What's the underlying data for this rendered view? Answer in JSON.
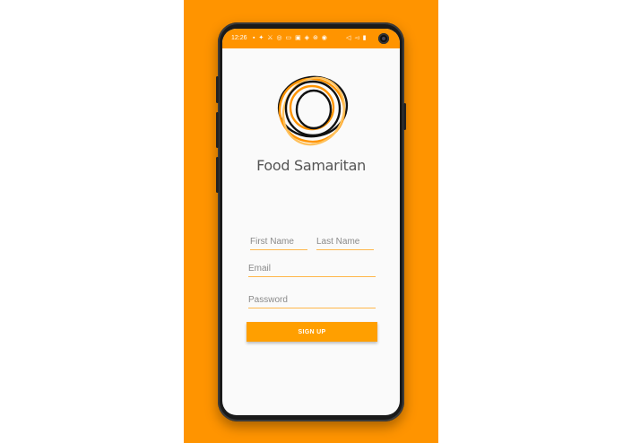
{
  "status_bar": {
    "time": "12:26",
    "left_icons": "▪ ✦ ⚔ ◎ ▭ ▣ ◈ ⊛ ◉",
    "right_icons": "◁ ◅ ▮"
  },
  "app": {
    "title": "Food Samaritan"
  },
  "form": {
    "first_name_placeholder": "First Name",
    "last_name_placeholder": "Last Name",
    "email_placeholder": "Email",
    "password_placeholder": "Password",
    "signup_label": "SIGN UP"
  },
  "colors": {
    "brand_orange": "#ff9400",
    "button_orange": "#ff9f00",
    "underline": "#ffb74d"
  }
}
